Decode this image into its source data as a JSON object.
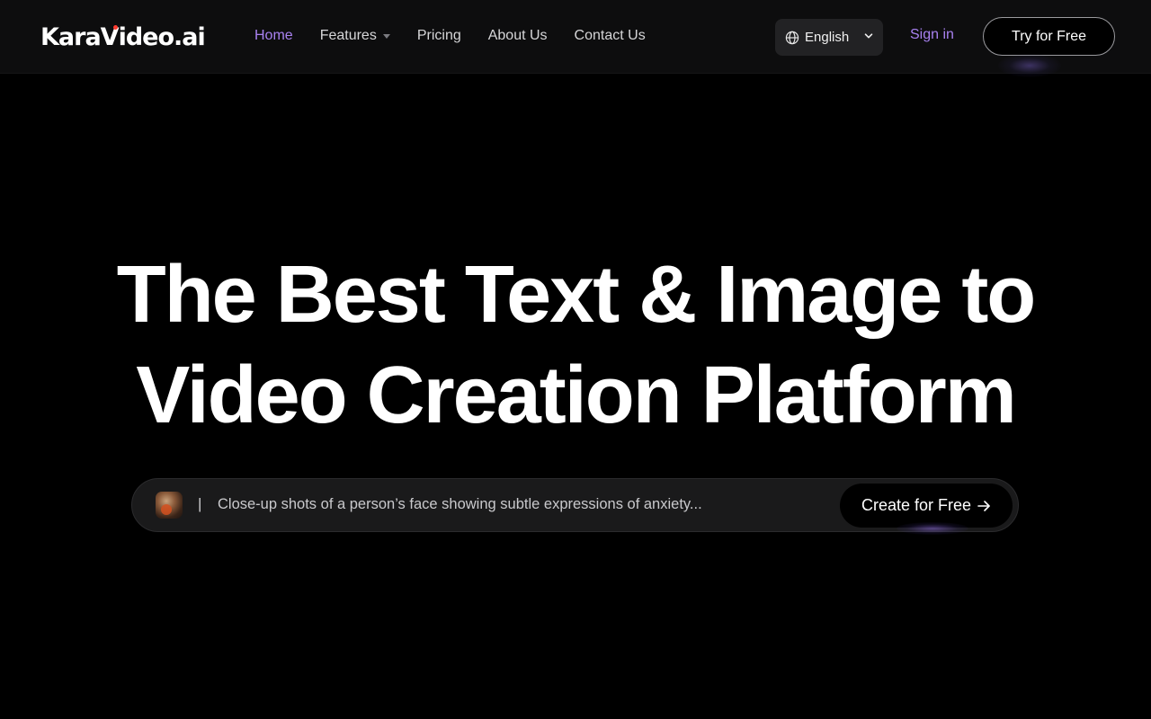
{
  "header": {
    "logo_text_left": "KaraV",
    "logo_text_right": "ideo.ai",
    "nav": [
      {
        "label": "Home",
        "active": true
      },
      {
        "label": "Features",
        "has_dropdown": true
      },
      {
        "label": "Pricing"
      },
      {
        "label": "About Us"
      },
      {
        "label": "Contact Us"
      }
    ],
    "language": {
      "label": "English",
      "icon": "globe-icon"
    },
    "sign_in_label": "Sign in",
    "try_free_label": "Try for Free"
  },
  "hero": {
    "title_line1": "The Best Text & Image to",
    "title_line2": "Video Creation Platform"
  },
  "prompt": {
    "cursor": "|",
    "text": "Close-up shots of a person’s face showing subtle expressions of anxiety...",
    "create_label": "Create for Free"
  },
  "colors": {
    "accent": "#a881f0",
    "background": "#000000",
    "header_bg": "#0d0d0e",
    "logo_dot": "#ff3b2f"
  }
}
